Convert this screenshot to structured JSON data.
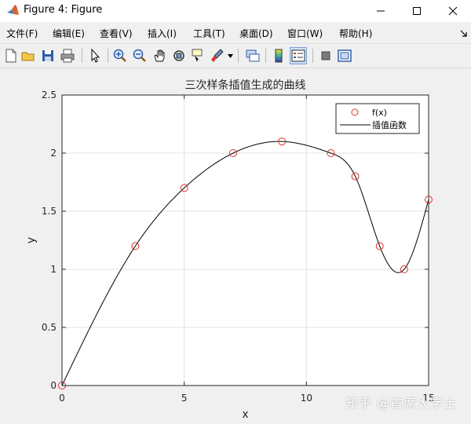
{
  "window": {
    "title": "Figure 4: Figure",
    "controls": {
      "minimize": "minimize-icon",
      "maximize": "maximize-icon",
      "close": "close-icon"
    }
  },
  "menu": {
    "items": [
      "文件(F)",
      "编辑(E)",
      "查看(V)",
      "插入(I)",
      "工具(T)",
      "桌面(D)",
      "窗口(W)",
      "帮助(H)"
    ]
  },
  "toolbar": {
    "icons": [
      "new-figure-icon",
      "open-file-icon",
      "save-icon",
      "print-icon",
      "pointer-icon",
      "zoom-in-icon",
      "zoom-out-icon",
      "pan-icon",
      "rotate-3d-icon",
      "data-cursor-icon",
      "brush-icon",
      "brush-dropdown-icon",
      "link-plot-icon",
      "colorbar-icon",
      "legend-icon",
      "hide-plot-tools-icon",
      "show-plot-tools-icon"
    ]
  },
  "watermark": "知乎 @首席大学士",
  "colors": {
    "marker": "#e0312b",
    "line": "#000000",
    "grid": "#e3e3e3",
    "axes_bg": "#ffffff",
    "figure_bg": "#f0f0f0"
  },
  "chart_data": {
    "type": "line",
    "title": "三次样条插值生成的曲线",
    "xlabel": "x",
    "ylabel": "y",
    "xlim": [
      0,
      15
    ],
    "ylim": [
      0,
      2.5
    ],
    "xticks": [
      0,
      5,
      10,
      15
    ],
    "yticks": [
      0,
      0.5,
      1,
      1.5,
      2,
      2.5
    ],
    "xtick_labels": [
      "0",
      "5",
      "10",
      "15"
    ],
    "ytick_labels": [
      "0",
      "0.5",
      "1",
      "1.5",
      "2",
      "2.5"
    ],
    "grid": true,
    "legend_position": "top-right",
    "series": [
      {
        "name": "f(x)",
        "style": "markers",
        "marker": "circle",
        "x": [
          0,
          3,
          5,
          7,
          9,
          11,
          12,
          13,
          14,
          15
        ],
        "y": [
          0,
          1.2,
          1.7,
          2.0,
          2.1,
          2.0,
          1.8,
          1.2,
          1.0,
          1.6
        ]
      },
      {
        "name": "插值函数",
        "style": "line",
        "interpolation": "cubic-spline",
        "x": [
          0,
          3,
          5,
          7,
          9,
          11,
          12,
          13,
          14,
          15
        ],
        "y": [
          0,
          1.2,
          1.7,
          2.0,
          2.1,
          2.0,
          1.8,
          1.2,
          1.0,
          1.6
        ]
      }
    ]
  }
}
